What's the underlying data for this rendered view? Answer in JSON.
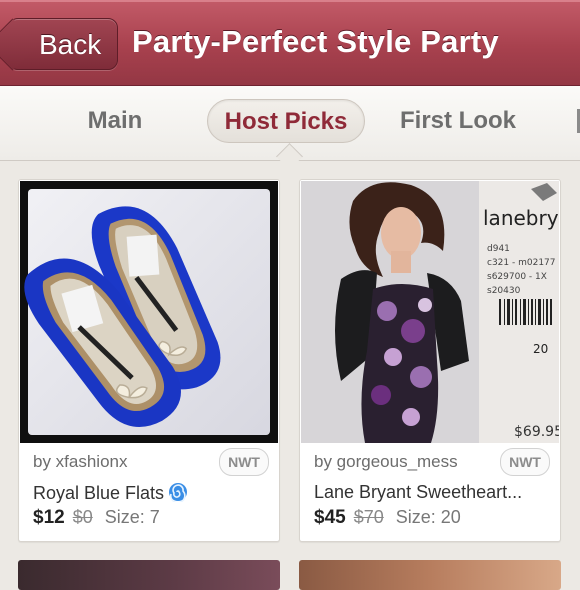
{
  "header": {
    "back_label": "Back",
    "title": "Party-Perfect Style Party",
    "color": "#a8414e"
  },
  "tabs": [
    {
      "label": "Main",
      "selected": false
    },
    {
      "label": "Host Picks",
      "selected": true
    },
    {
      "label": "First Look",
      "selected": false
    }
  ],
  "listings": [
    {
      "seller": "by xfashionx",
      "badge": "NWT",
      "title": "Royal Blue Flats",
      "title_icon": "spiral-emoji-icon",
      "price": "$12",
      "original_price": "$0",
      "size": "Size: 7",
      "photo": "blue-ballet-flats-photo"
    },
    {
      "seller": "by gorgeous_mess",
      "badge": "NWT",
      "title": "Lane Bryant Sweetheart...",
      "price": "$45",
      "original_price": "$70",
      "size": "Size: 20",
      "photo": "floral-dress-photo",
      "photo_text": {
        "brand": "lanebrya",
        "code1": "d941",
        "code2": "c321 - m02177",
        "code3": "s629700 - 1X",
        "code4": "s20430",
        "size": "20",
        "price": "$69.95"
      }
    }
  ],
  "accent_color": "#8f2a38"
}
